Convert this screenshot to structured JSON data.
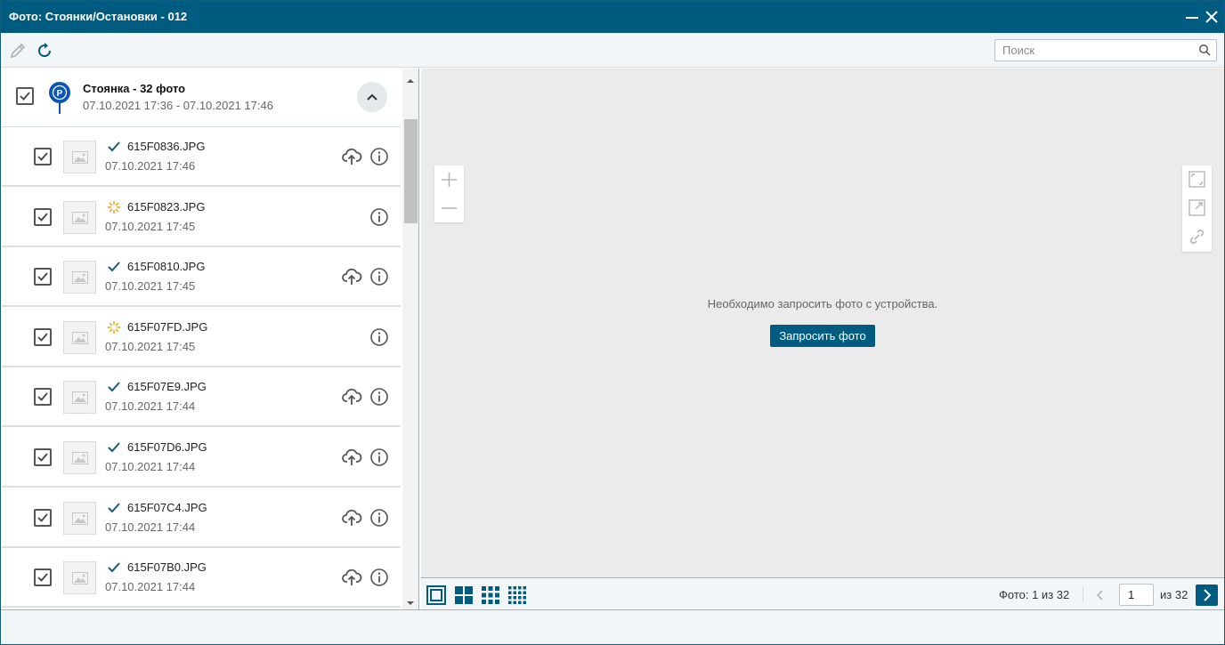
{
  "window": {
    "title": "Фото: Стоянки/Остановки - 012"
  },
  "toolbar": {
    "search_placeholder": "Поиск"
  },
  "group": {
    "title": "Стоянка - 32 фото",
    "dates": "07.10.2021 17:36 - 07.10.2021 17:46"
  },
  "photos": [
    {
      "name": "615F0836.JPG",
      "date": "07.10.2021 17:46",
      "status": "downloaded",
      "upload": true
    },
    {
      "name": "615F0823.JPG",
      "date": "07.10.2021 17:45",
      "status": "pending",
      "upload": false
    },
    {
      "name": "615F0810.JPG",
      "date": "07.10.2021 17:45",
      "status": "downloaded",
      "upload": true
    },
    {
      "name": "615F07FD.JPG",
      "date": "07.10.2021 17:45",
      "status": "pending",
      "upload": false
    },
    {
      "name": "615F07E9.JPG",
      "date": "07.10.2021 17:44",
      "status": "downloaded",
      "upload": true
    },
    {
      "name": "615F07D6.JPG",
      "date": "07.10.2021 17:44",
      "status": "downloaded",
      "upload": true
    },
    {
      "name": "615F07C4.JPG",
      "date": "07.10.2021 17:44",
      "status": "downloaded",
      "upload": true
    },
    {
      "name": "615F07B0.JPG",
      "date": "07.10.2021 17:44",
      "status": "downloaded",
      "upload": true
    }
  ],
  "viewer": {
    "message": "Необходимо запросить фото с устройства.",
    "request_button": "Запросить фото"
  },
  "pagination": {
    "photo_count": "Фото: 1 из 32",
    "page": "1",
    "of_total": "из 32"
  },
  "colors": {
    "primary": "#005b80",
    "check": "#1a5d73",
    "pending": "#f0a81e"
  }
}
